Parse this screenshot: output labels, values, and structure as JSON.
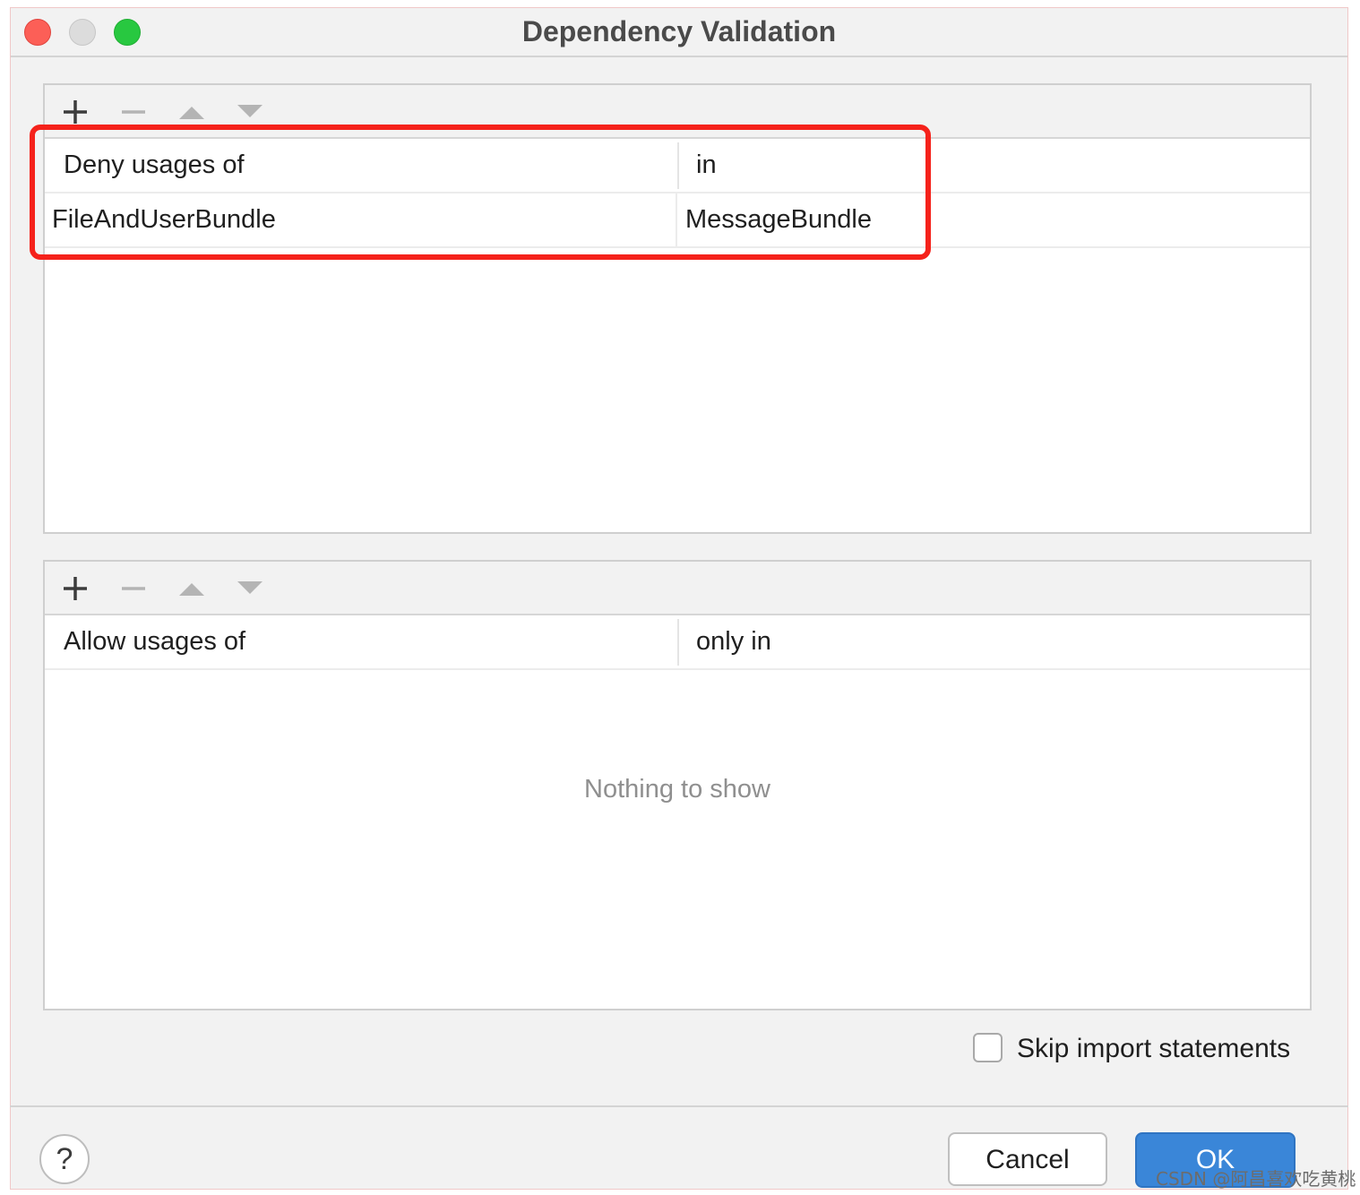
{
  "window": {
    "title": "Dependency Validation"
  },
  "toolbar_icons": {
    "add": "plus-icon",
    "remove": "minus-icon",
    "move_up": "triangle-up-icon",
    "move_down": "triangle-down-icon"
  },
  "deny_table": {
    "columns": [
      "Deny usages of",
      "in"
    ],
    "rows": [
      [
        "FileAndUserBundle",
        "MessageBundle"
      ]
    ]
  },
  "allow_table": {
    "columns": [
      "Allow usages of",
      "only in"
    ],
    "empty_text": "Nothing to show"
  },
  "options": {
    "skip_imports_label": "Skip import statements",
    "skip_imports_checked": false
  },
  "footer": {
    "help_label": "?",
    "cancel_label": "Cancel",
    "ok_label": "OK"
  },
  "watermark": "CSDN @阿昌喜欢吃黄桃",
  "colors": {
    "highlight": "#f5221b",
    "ok_button": "#3a86d8",
    "close": "#fc5f57",
    "maximize": "#28c840"
  }
}
